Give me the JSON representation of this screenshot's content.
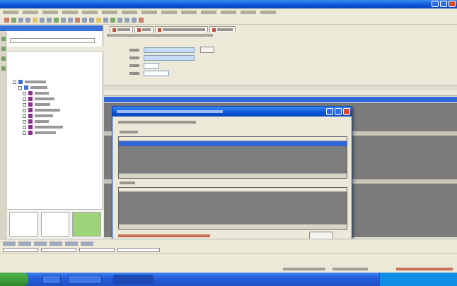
{
  "window": {
    "title": ""
  },
  "menu": {
    "items": [
      "",
      "",
      "",
      "",
      "",
      "",
      "",
      "",
      "",
      "",
      "",
      "",
      "",
      ""
    ]
  },
  "tabs": [
    {
      "label": ""
    },
    {
      "label": ""
    },
    {
      "label": ""
    },
    {
      "label": ""
    }
  ],
  "form": {
    "fields": [
      {
        "label": "",
        "value": ""
      },
      {
        "label": "",
        "value": ""
      },
      {
        "label": "",
        "value": ""
      },
      {
        "label": "",
        "value": ""
      }
    ],
    "button_label": ""
  },
  "dialog": {
    "title": "",
    "ok_label": "",
    "status_text": ""
  },
  "colors": {
    "titlebar": "#0a54d6",
    "selection": "#3168d5",
    "grid_bg": "#7b7b7b",
    "status_text": "#c0503a",
    "start_button": "#2f8b2b"
  },
  "icons": [
    "window-close-icon",
    "tree-folder-icon",
    "tree-expand-icon",
    "toolbar-icon",
    "tab-close-icon"
  ]
}
